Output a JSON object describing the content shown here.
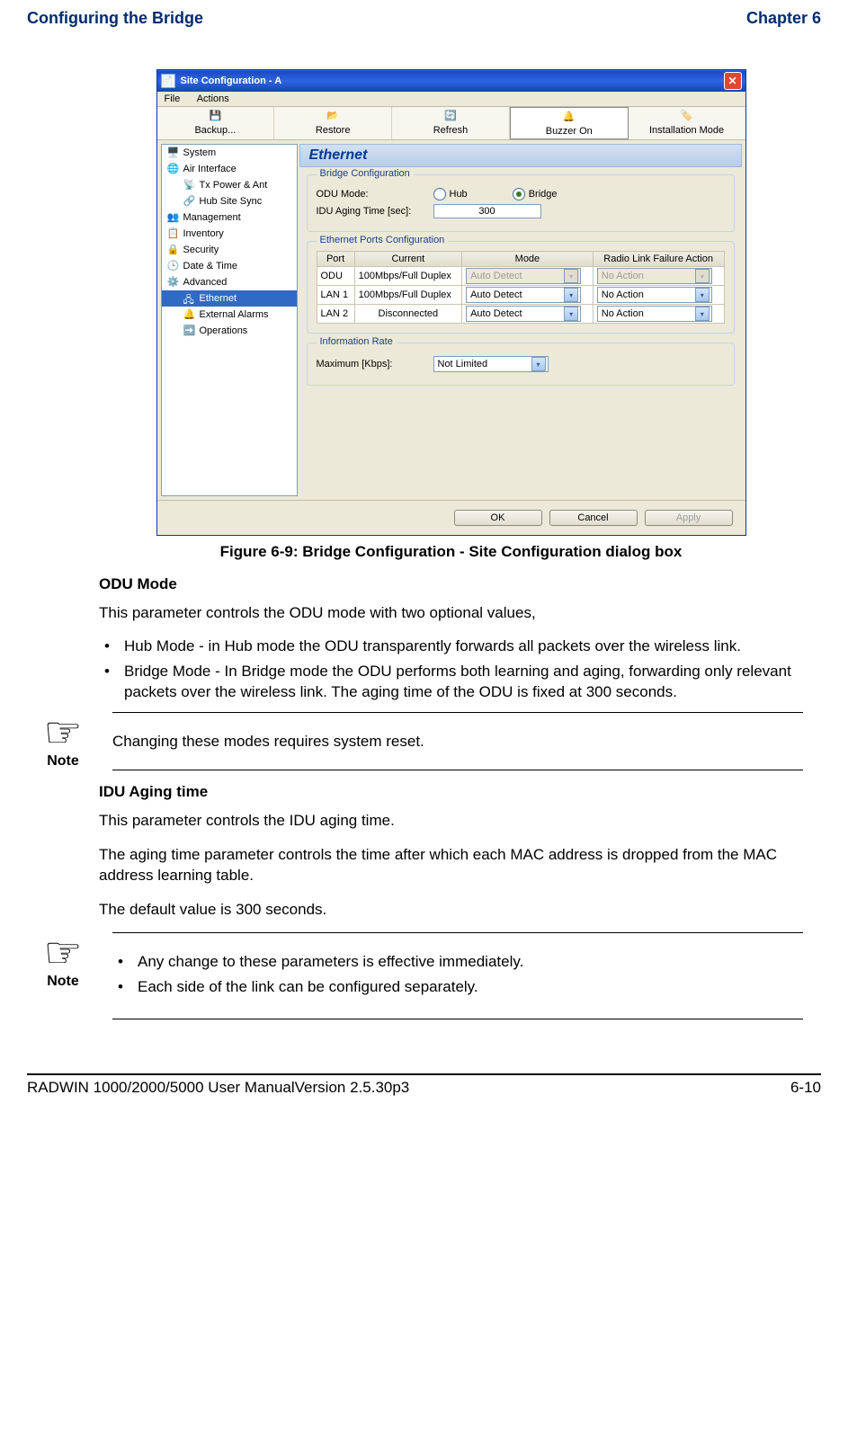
{
  "header": {
    "left": "Configuring the Bridge",
    "right": "Chapter 6"
  },
  "dialog": {
    "title": "Site Configuration - A",
    "menu": [
      "File",
      "Actions"
    ],
    "toolbar": [
      {
        "label": "Backup...",
        "icon": "save-icon"
      },
      {
        "label": "Restore",
        "icon": "restore-icon"
      },
      {
        "label": "Refresh",
        "icon": "refresh-icon"
      },
      {
        "label": "Buzzer On",
        "icon": "buzzer-icon"
      },
      {
        "label": "Installation Mode",
        "icon": "install-icon"
      }
    ],
    "sidebar": [
      {
        "label": "System",
        "indent": false
      },
      {
        "label": "Air Interface",
        "indent": false
      },
      {
        "label": "Tx Power & Ant",
        "indent": true
      },
      {
        "label": "Hub Site Sync",
        "indent": true
      },
      {
        "label": "Management",
        "indent": false
      },
      {
        "label": "Inventory",
        "indent": false
      },
      {
        "label": "Security",
        "indent": false
      },
      {
        "label": "Date & Time",
        "indent": false
      },
      {
        "label": "Advanced",
        "indent": false
      },
      {
        "label": "Ethernet",
        "indent": true,
        "selected": true
      },
      {
        "label": "External Alarms",
        "indent": true
      },
      {
        "label": "Operations",
        "indent": true
      }
    ],
    "panel_title": "Ethernet",
    "bridge_config": {
      "legend": "Bridge Configuration",
      "odu_mode_label": "ODU Mode:",
      "hub_label": "Hub",
      "bridge_label": "Bridge",
      "selected": "Bridge",
      "aging_label": "IDU Aging Time [sec]:",
      "aging_value": "300"
    },
    "ports": {
      "legend": "Ethernet Ports Configuration",
      "headers": [
        "Port",
        "Current",
        "Mode",
        "Radio Link Failure Action"
      ],
      "rows": [
        {
          "port": "ODU",
          "current": "100Mbps/Full Duplex",
          "mode": "Auto Detect",
          "action": "No Action",
          "disabled": true
        },
        {
          "port": "LAN 1",
          "current": "100Mbps/Full Duplex",
          "mode": "Auto Detect",
          "action": "No Action",
          "disabled": false
        },
        {
          "port": "LAN 2",
          "current": "Disconnected",
          "mode": "Auto Detect",
          "action": "No Action",
          "disabled": false
        }
      ]
    },
    "info_rate": {
      "legend": "Information Rate",
      "label": "Maximum [Kbps]:",
      "value": "Not Limited"
    },
    "buttons": {
      "ok": "OK",
      "cancel": "Cancel",
      "apply": "Apply"
    }
  },
  "figure_caption": "Figure 6-9: Bridge Configuration - Site Configuration dialog box",
  "odu": {
    "heading": "ODU Mode",
    "intro": "This parameter controls the ODU mode with two optional values,",
    "bullets": [
      "Hub Mode - in Hub mode the ODU transparently forwards all packets over the wireless link.",
      "Bridge Mode - In Bridge mode the ODU performs both learning and aging, forwarding only relevant packets over the wireless link. The aging time of the ODU is fixed at 300 seconds."
    ]
  },
  "note1": {
    "label": "Note",
    "text": "Changing these modes requires system reset."
  },
  "idu": {
    "heading": "IDU Aging time",
    "p1": "This parameter controls the IDU aging time.",
    "p2": "The aging time parameter controls the time after which each MAC address is dropped from the MAC address learning table.",
    "p3": "The default value is 300 seconds."
  },
  "note2": {
    "label": "Note",
    "bullets": [
      "Any change to these parameters is effective immediately.",
      "Each side of the link can be configured separately."
    ]
  },
  "footer": {
    "left": "RADWIN 1000/2000/5000 User ManualVersion  2.5.30p3",
    "right": "6-10"
  }
}
